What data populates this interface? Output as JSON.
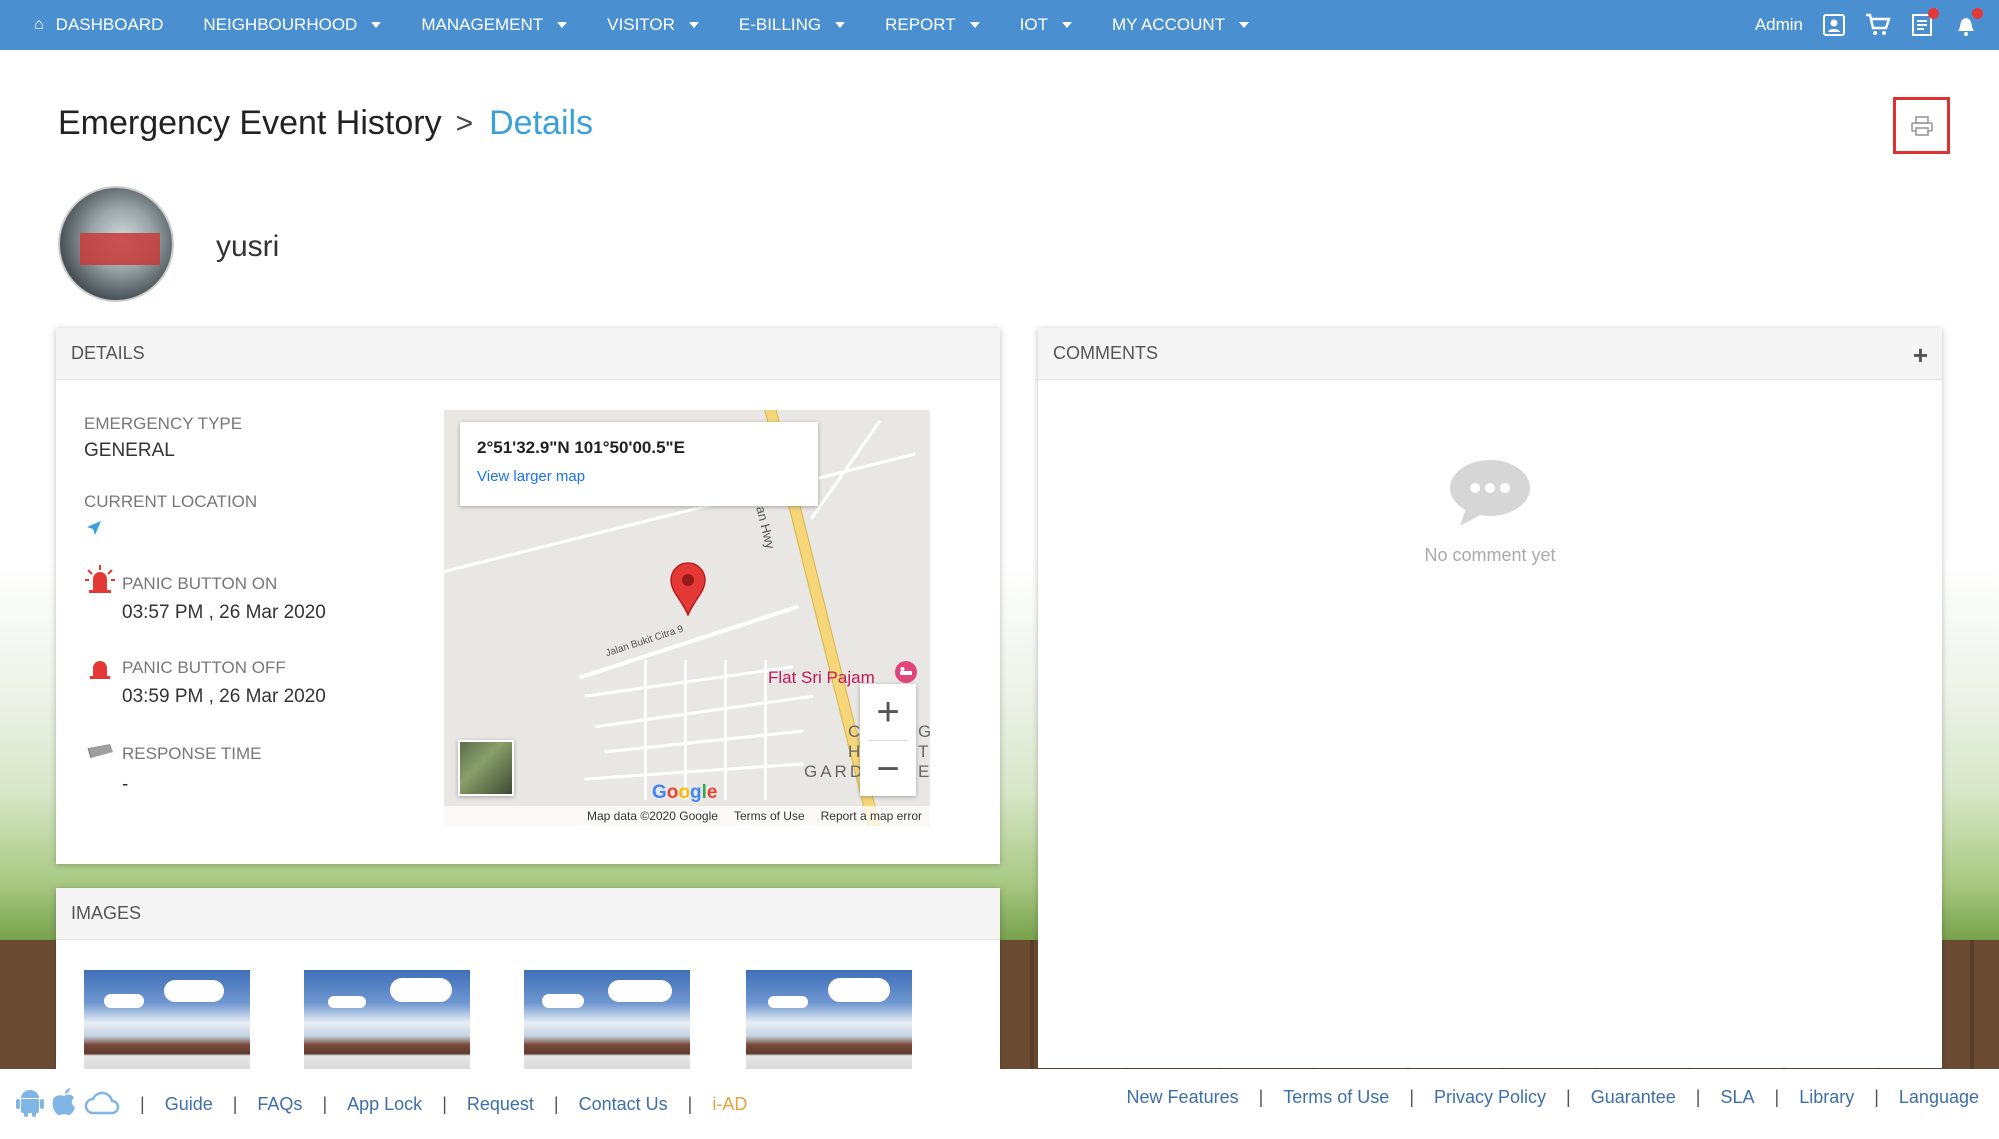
{
  "nav": {
    "items": [
      {
        "label": "DASHBOARD",
        "has_caret": false
      },
      {
        "label": "NEIGHBOURHOOD",
        "has_caret": true
      },
      {
        "label": "MANAGEMENT",
        "has_caret": true
      },
      {
        "label": "VISITOR",
        "has_caret": true
      },
      {
        "label": "E-BILLING",
        "has_caret": true
      },
      {
        "label": "REPORT",
        "has_caret": true
      },
      {
        "label": "IOT",
        "has_caret": true
      },
      {
        "label": "MY ACCOUNT",
        "has_caret": true
      }
    ],
    "user_label": "Admin",
    "icons": [
      "profile-icon",
      "cart-icon",
      "notes-icon",
      "notification-bell-icon"
    ],
    "color": "#4a90d0"
  },
  "page": {
    "breadcrumb_parent": "Emergency Event History",
    "breadcrumb_separator": ">",
    "breadcrumb_current": "Details",
    "username": "yusri"
  },
  "details": {
    "header": "DETAILS",
    "emergency_type_label": "EMERGENCY TYPE",
    "emergency_type_value": "GENERAL",
    "current_location_label": "CURRENT LOCATION",
    "panic_on_label": "PANIC BUTTON ON",
    "panic_on_value": "03:57 PM , 26 Mar 2020",
    "panic_off_label": "PANIC BUTTON OFF",
    "panic_off_value": "03:59 PM , 26 Mar 2020",
    "response_time_label": "RESPONSE TIME",
    "response_time_value": "-"
  },
  "map": {
    "coordinates": "2°51'32.9\"N 101°50'00.5\"E",
    "larger_map_link": "View larger map",
    "street_label": "Jalan Bukit Citra 9",
    "place_label": "Flat Sri Pajam",
    "hwy_label": "an Hwy",
    "area_label_1": "C",
    "area_label_2": "H",
    "area_label_3": "GARD",
    "area_label_4": "G",
    "area_label_5": "T",
    "area_label_6": "E",
    "zoom_in": "+",
    "zoom_out": "−",
    "google_logo": "Google",
    "footer_data": "Map data ©2020 Google",
    "footer_terms": "Terms of Use",
    "footer_report": "Report a map error"
  },
  "comments": {
    "header": "COMMENTS",
    "add_label": "+",
    "empty_text": "No comment yet"
  },
  "images": {
    "header": "IMAGES",
    "count": 4
  },
  "footer": {
    "left_links": [
      "Guide",
      "FAQs",
      "App Lock",
      "Request",
      "Contact Us"
    ],
    "brand_link": "i-AD",
    "right_links": [
      "New Features",
      "Terms of Use",
      "Privacy Policy",
      "Guarantee",
      "SLA",
      "Library",
      "Language"
    ],
    "separator": "|",
    "platform_icons": [
      "android-icon",
      "apple-icon",
      "cloud-icon"
    ]
  }
}
